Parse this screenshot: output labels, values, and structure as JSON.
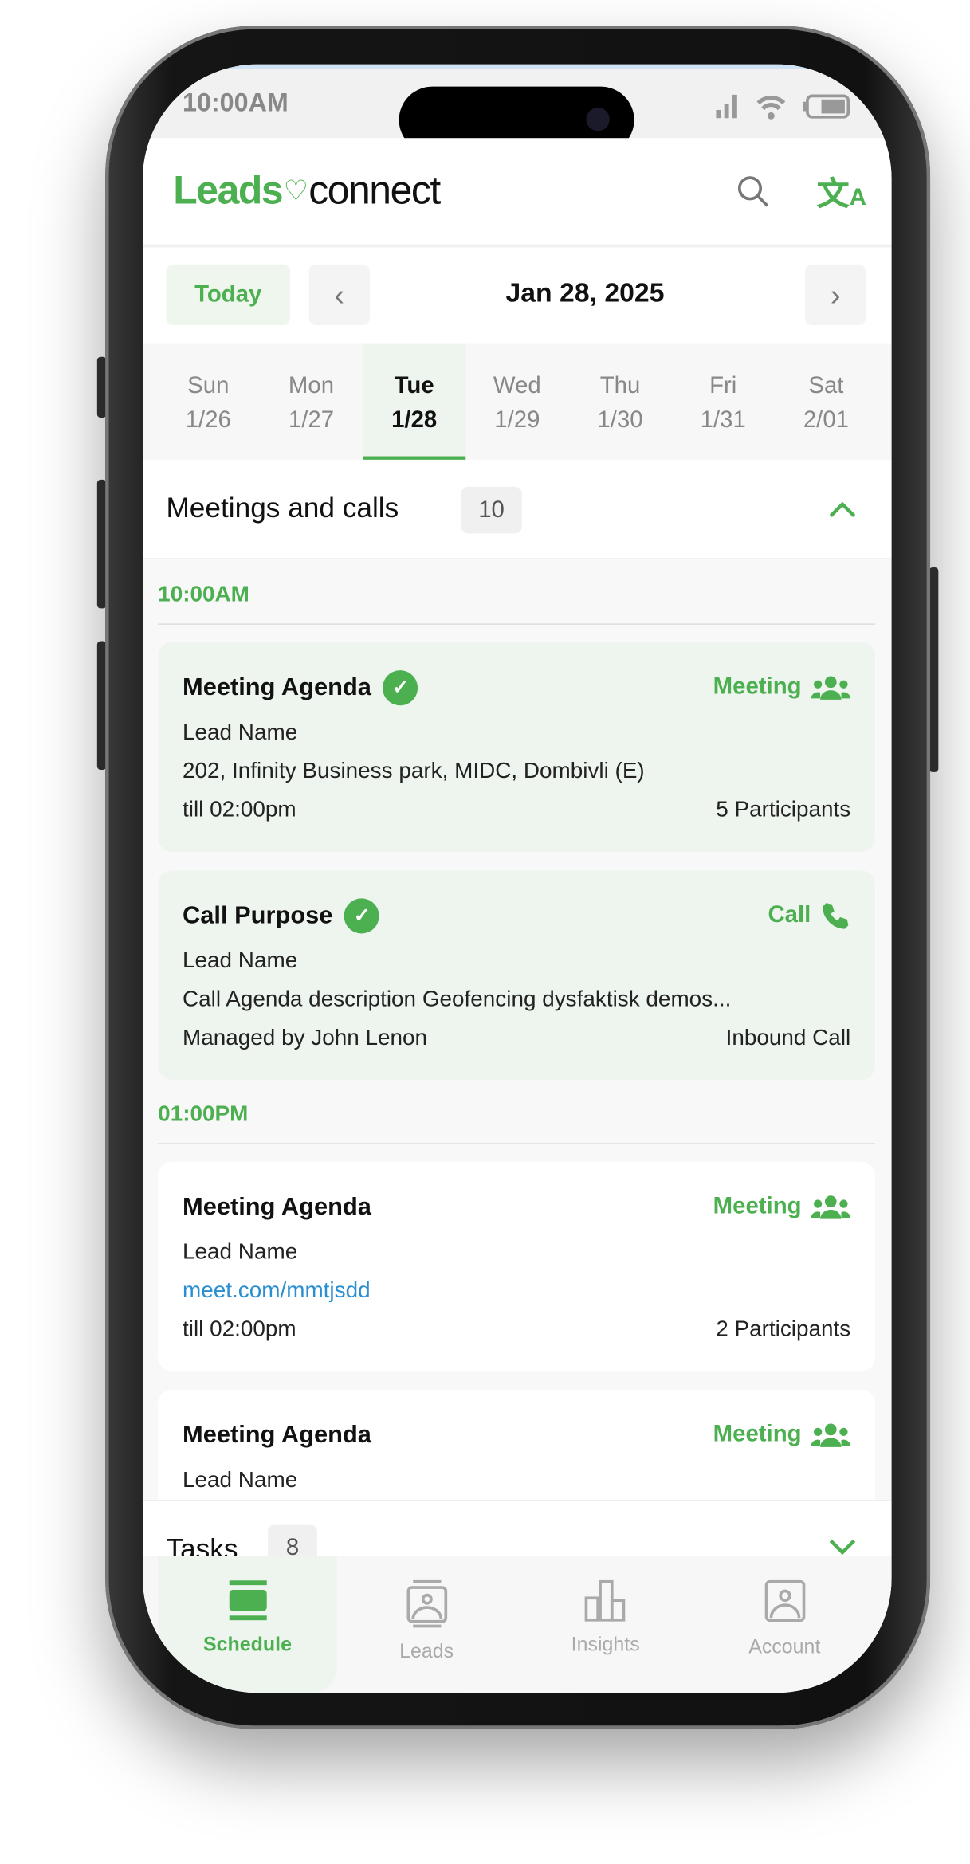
{
  "status_bar": {
    "time": "10:00AM"
  },
  "header": {
    "logo_left": "Leads",
    "logo_right": "connect",
    "search_icon": "search-icon",
    "translate_icon": "translate-icon"
  },
  "date_nav": {
    "today_label": "Today",
    "current_date": "Jan 28, 2025"
  },
  "week": [
    {
      "day": "Sun",
      "date": "1/26"
    },
    {
      "day": "Mon",
      "date": "1/27"
    },
    {
      "day": "Tue",
      "date": "1/28",
      "selected": true
    },
    {
      "day": "Wed",
      "date": "1/29"
    },
    {
      "day": "Thu",
      "date": "1/30"
    },
    {
      "day": "Fri",
      "date": "1/31"
    },
    {
      "day": "Sat",
      "date": "2/01"
    }
  ],
  "meetings": {
    "title": "Meetings and calls",
    "count": "10",
    "groups": [
      {
        "time": "10:00AM",
        "items": [
          {
            "title": "Meeting Agenda",
            "done": true,
            "type": "Meeting",
            "lead": "Lead Name",
            "detail": "202, Infinity Business park, MIDC, Dombivli (E)",
            "footer_left": "till 02:00pm",
            "footer_right": "5 Participants"
          },
          {
            "title": "Call Purpose",
            "done": true,
            "type": "Call",
            "lead": "Lead Name",
            "detail": "Call Agenda description Geofencing dysfaktisk demos...",
            "footer_left": "Managed by John Lenon",
            "footer_right": "Inbound Call"
          }
        ]
      },
      {
        "time": "01:00PM",
        "items": [
          {
            "title": "Meeting Agenda",
            "done": false,
            "type": "Meeting",
            "lead": "Lead Name",
            "detail": "meet.com/mmtjsdd",
            "footer_left": "till 02:00pm",
            "footer_right": "2 Participants"
          },
          {
            "title": "Meeting Agenda",
            "done": false,
            "type": "Meeting",
            "lead": "Lead Name"
          }
        ]
      }
    ]
  },
  "tasks": {
    "title": "Tasks",
    "count": "8"
  },
  "bottom_nav": [
    {
      "label": "Schedule",
      "selected": true
    },
    {
      "label": "Leads"
    },
    {
      "label": "Insights"
    },
    {
      "label": "Account"
    }
  ],
  "colors": {
    "accent": "#4caf50",
    "link": "#2a8fd0",
    "card_done_bg": "#eef4ee"
  }
}
